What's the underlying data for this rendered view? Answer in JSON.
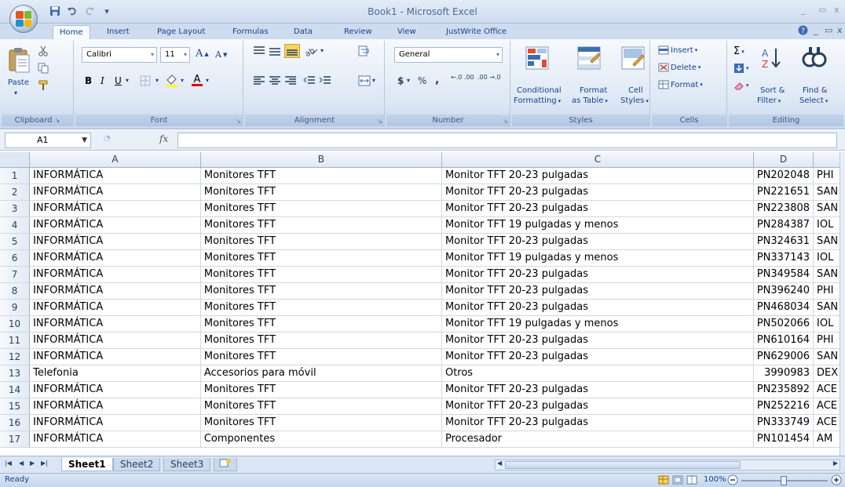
{
  "window": {
    "title": "Book1 - Microsoft Excel",
    "minimize": "_",
    "restore": "▭",
    "close": "x"
  },
  "tabs": [
    "Home",
    "Insert",
    "Page Layout",
    "Formulas",
    "Data",
    "Review",
    "View",
    "JustWrite Office"
  ],
  "ribbon": {
    "clipboard": {
      "label": "Clipboard",
      "paste": "Paste"
    },
    "font": {
      "label": "Font",
      "name": "Calibri",
      "size": "11",
      "bold": "B",
      "italic": "I",
      "underline": "U",
      "grow": "A",
      "shrink": "A"
    },
    "alignment": {
      "label": "Alignment"
    },
    "number": {
      "label": "Number",
      "format": "General",
      "currency": "$",
      "percent": "%",
      "comma": ",",
      "inc_dec": "←.0 .00",
      "dec_dec": ".00 →.0"
    },
    "styles": {
      "label": "Styles",
      "conditional": "Conditional",
      "formatting": "Formatting",
      "format": "Format",
      "as_table": "as Table",
      "cell": "Cell",
      "cell_styles": "Styles"
    },
    "cells": {
      "label": "Cells",
      "insert": "Insert",
      "delete": "Delete",
      "format": "Format"
    },
    "editing": {
      "label": "Editing",
      "sort": "Sort &",
      "filter": "Filter",
      "find": "Find &",
      "select": "Select"
    }
  },
  "formula_bar": {
    "name_box": "A1",
    "fx": "fx",
    "content": ""
  },
  "columns": [
    "A",
    "B",
    "C",
    "D"
  ],
  "rows": [
    {
      "n": "1",
      "a": "INFORMÁTICA",
      "b": "Monitores TFT",
      "c": "Monitor TFT 20-23 pulgadas",
      "d": "PN202048",
      "e": "PHI"
    },
    {
      "n": "2",
      "a": "INFORMÁTICA",
      "b": "Monitores TFT",
      "c": "Monitor TFT 20-23 pulgadas",
      "d": "PN221651",
      "e": "SAN"
    },
    {
      "n": "3",
      "a": "INFORMÁTICA",
      "b": "Monitores TFT",
      "c": "Monitor TFT 20-23 pulgadas",
      "d": "PN223808",
      "e": "SAN"
    },
    {
      "n": "4",
      "a": "INFORMÁTICA",
      "b": "Monitores TFT",
      "c": "Monitor TFT 19 pulgadas y menos",
      "d": "PN284387",
      "e": "IOL"
    },
    {
      "n": "5",
      "a": "INFORMÁTICA",
      "b": "Monitores TFT",
      "c": "Monitor TFT 20-23 pulgadas",
      "d": "PN324631",
      "e": "SAN"
    },
    {
      "n": "6",
      "a": "INFORMÁTICA",
      "b": "Monitores TFT",
      "c": "Monitor TFT 19 pulgadas y menos",
      "d": "PN337143",
      "e": "IOL"
    },
    {
      "n": "7",
      "a": "INFORMÁTICA",
      "b": "Monitores TFT",
      "c": "Monitor TFT 20-23 pulgadas",
      "d": "PN349584",
      "e": "SAN"
    },
    {
      "n": "8",
      "a": "INFORMÁTICA",
      "b": "Monitores TFT",
      "c": "Monitor TFT 20-23 pulgadas",
      "d": "PN396240",
      "e": "PHI"
    },
    {
      "n": "9",
      "a": "INFORMÁTICA",
      "b": "Monitores TFT",
      "c": "Monitor TFT 20-23 pulgadas",
      "d": "PN468034",
      "e": "SAN"
    },
    {
      "n": "10",
      "a": "INFORMÁTICA",
      "b": "Monitores TFT",
      "c": "Monitor TFT 19 pulgadas y menos",
      "d": "PN502066",
      "e": "IOL"
    },
    {
      "n": "11",
      "a": "INFORMÁTICA",
      "b": "Monitores TFT",
      "c": "Monitor TFT 20-23 pulgadas",
      "d": "PN610164",
      "e": "PHI"
    },
    {
      "n": "12",
      "a": "INFORMÁTICA",
      "b": "Monitores TFT",
      "c": "Monitor TFT 20-23 pulgadas",
      "d": "PN629006",
      "e": "SAN"
    },
    {
      "n": "13",
      "a": "Telefonia",
      "b": "Accesorios para móvil",
      "c": "Otros",
      "d": "3990983",
      "e": "DEX"
    },
    {
      "n": "14",
      "a": "INFORMÁTICA",
      "b": "Monitores TFT",
      "c": "Monitor TFT 20-23 pulgadas",
      "d": "PN235892",
      "e": "ACE"
    },
    {
      "n": "15",
      "a": "INFORMÁTICA",
      "b": "Monitores TFT",
      "c": "Monitor TFT 20-23 pulgadas",
      "d": "PN252216",
      "e": "ACE"
    },
    {
      "n": "16",
      "a": "INFORMÁTICA",
      "b": "Monitores TFT",
      "c": "Monitor TFT 20-23 pulgadas",
      "d": "PN333749",
      "e": "ACE"
    },
    {
      "n": "17",
      "a": "INFORMÁTICA",
      "b": "Componentes",
      "c": "Procesador",
      "d": "PN101454",
      "e": "AM"
    }
  ],
  "sheets": [
    "Sheet1",
    "Sheet2",
    "Sheet3"
  ],
  "status": {
    "ready": "Ready",
    "zoom": "100%"
  },
  "colors": {
    "accent": "#15428b",
    "grid_line": "#d0d7e5",
    "header_bg": "#dfe7f2"
  }
}
